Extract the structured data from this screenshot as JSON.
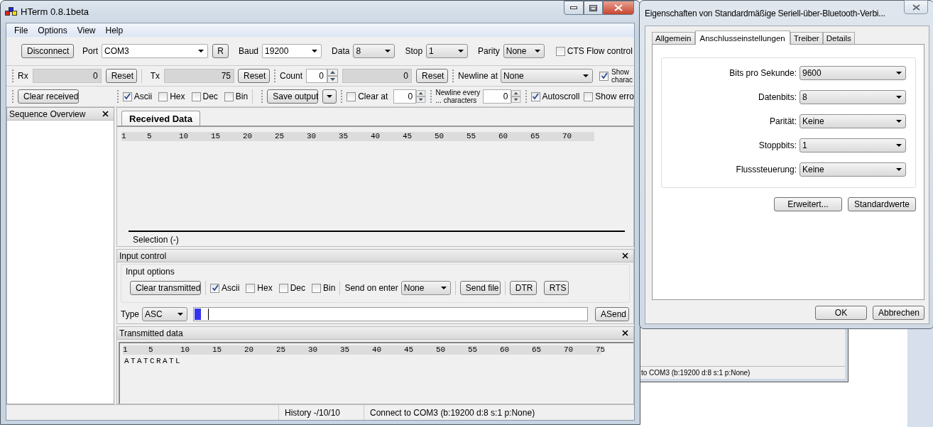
{
  "hterm": {
    "title": "HTerm 0.8.1beta",
    "menu": [
      "File",
      "Options",
      "View",
      "Help"
    ],
    "connection": {
      "disconnect": "Disconnect",
      "port": {
        "label": "Port",
        "value": "COM3"
      },
      "refresh": "R",
      "baud": {
        "label": "Baud",
        "value": "19200"
      },
      "data": {
        "label": "Data",
        "value": "8"
      },
      "stop": {
        "label": "Stop",
        "value": "1"
      },
      "parity": {
        "label": "Parity",
        "value": "None"
      },
      "cts": {
        "label": "CTS Flow control",
        "checked": false
      }
    },
    "counters": {
      "rx": {
        "label": "Rx",
        "value": "0",
        "reset": "Reset"
      },
      "tx": {
        "label": "Tx",
        "value": "75",
        "reset": "Reset"
      },
      "count": {
        "label": "Count",
        "value": "0",
        "total": "0",
        "reset": "Reset"
      },
      "newline_at": {
        "label": "Newline at",
        "value": "None"
      },
      "show_characters": {
        "label_lines": [
          "Show",
          "charac"
        ],
        "checked": true
      }
    },
    "display": {
      "clear_received": "Clear received",
      "formats": [
        {
          "label": "Ascii",
          "checked": true
        },
        {
          "label": "Hex",
          "checked": false
        },
        {
          "label": "Dec",
          "checked": false
        },
        {
          "label": "Bin",
          "checked": false
        }
      ],
      "save_output": "Save output",
      "clear_at": {
        "label": "Clear at",
        "checked": false,
        "value": "0"
      },
      "newline_every": {
        "label_lines": [
          "Newline every",
          "... characters"
        ],
        "value": "0"
      },
      "autoscroll": {
        "label": "Autoscroll",
        "checked": true
      },
      "show_errors": {
        "label": "Show erro",
        "checked": false
      }
    },
    "sequence_overview": {
      "title": "Sequence Overview"
    },
    "received": {
      "tab": "Received Data",
      "ruler": [
        "1",
        "5",
        "10",
        "15",
        "20",
        "25",
        "30",
        "35",
        "40",
        "45",
        "50",
        "55",
        "60",
        "65",
        "70"
      ],
      "selection": "Selection (-)"
    },
    "input_control": {
      "title": "Input control",
      "group": "Input options",
      "clear_transmitted": "Clear transmitted",
      "formats": [
        {
          "label": "Ascii",
          "checked": true
        },
        {
          "label": "Hex",
          "checked": false
        },
        {
          "label": "Dec",
          "checked": false
        },
        {
          "label": "Bin",
          "checked": false
        }
      ],
      "send_on_enter": {
        "label": "Send on enter",
        "value": "None"
      },
      "send_file": "Send file",
      "dtr": "DTR",
      "rts": "RTS",
      "type": {
        "label": "Type",
        "value": "ASC"
      },
      "asend": "ASend"
    },
    "transmitted": {
      "title": "Transmitted data",
      "ruler": [
        "1",
        "5",
        "10",
        "15",
        "20",
        "25",
        "30",
        "35",
        "40",
        "45",
        "50",
        "55",
        "60",
        "65",
        "70",
        "75"
      ],
      "data": "ATATCRATL"
    },
    "status_bar": {
      "history": "History -/10/10",
      "connection": "Connect to COM3 (b:19200 d:8 s:1 p:None)"
    }
  },
  "dialog": {
    "title": "Eigenschaften von Standardmäßige Seriell-über-Bluetooth-Verbi...",
    "tabs": [
      {
        "label": "Allgemein",
        "selected": false
      },
      {
        "label": "Anschlusseinstellungen",
        "selected": true
      },
      {
        "label": "Treiber",
        "selected": false
      },
      {
        "label": "Details",
        "selected": false
      }
    ],
    "fields": [
      {
        "label": "Bits pro Sekunde:",
        "value": "9600"
      },
      {
        "label": "Datenbits:",
        "value": "8"
      },
      {
        "label": "Parität:",
        "value": "Keine"
      },
      {
        "label": "Stoppbits:",
        "value": "1"
      },
      {
        "label": "Flusssteuerung:",
        "value": "Keine"
      }
    ],
    "panel_buttons": [
      "Erweitert...",
      "Standardwerte"
    ],
    "buttons": [
      "OK",
      "Abbrechen"
    ]
  },
  "background_window": {
    "status": "to COM3 (b:19200 d:8 s:1 p:None)"
  }
}
